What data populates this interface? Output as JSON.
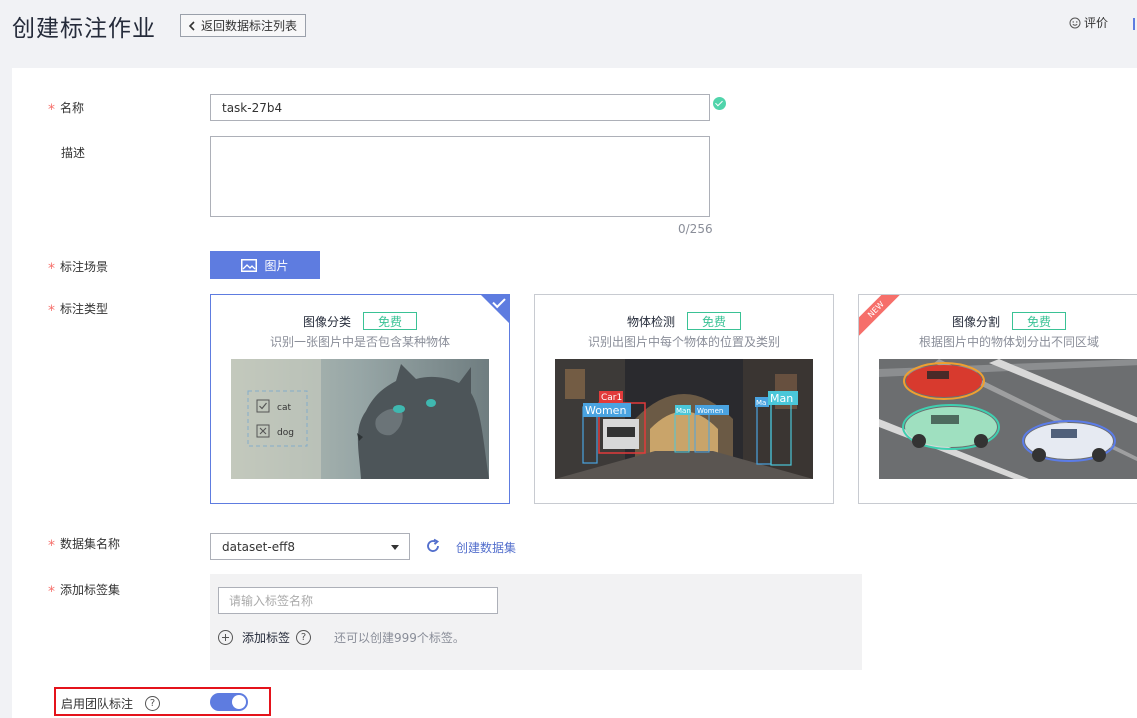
{
  "header": {
    "title": "创建标注作业",
    "back_label": "返回数据标注列表",
    "rate_label": "评价"
  },
  "form": {
    "name": {
      "label": "名称",
      "value": "task-27b4"
    },
    "description": {
      "label": "描述",
      "value": "",
      "counter": "0/256"
    },
    "scene": {
      "label": "标注场景",
      "option": "图片"
    },
    "type": {
      "label": "标注类型",
      "cards": [
        {
          "title": "图像分类",
          "badge": "免费",
          "desc": "识别一张图片中是否包含某种物体",
          "selected": true,
          "image_labels": [
            "cat",
            "dog"
          ]
        },
        {
          "title": "物体检测",
          "badge": "免费",
          "desc": "识别出图片中每个物体的位置及类别",
          "selected": false,
          "image_labels": [
            "Car1",
            "Women",
            "Man",
            "Women",
            "Ma",
            "Man"
          ]
        },
        {
          "title": "图像分割",
          "badge": "免费",
          "desc": "根据图片中的物体划分出不同区域",
          "selected": false,
          "ribbon": "NEW"
        }
      ]
    },
    "dataset": {
      "label": "数据集名称",
      "value": "dataset-eff8",
      "create_link": "创建数据集"
    },
    "labels": {
      "label": "添加标签集",
      "placeholder": "请输入标签名称",
      "add_label": "添加标签",
      "help": "?",
      "hint": "还可以创建999个标签。"
    },
    "team": {
      "label": "启用团队标注",
      "help": "?",
      "enabled": true
    }
  },
  "colors": {
    "primary": "#5e7ce0",
    "required": "#f66f6a",
    "success": "#50d4ab",
    "free_badge": "#3ac295",
    "highlight_border": "#e4131b",
    "link": "#526ecc"
  }
}
